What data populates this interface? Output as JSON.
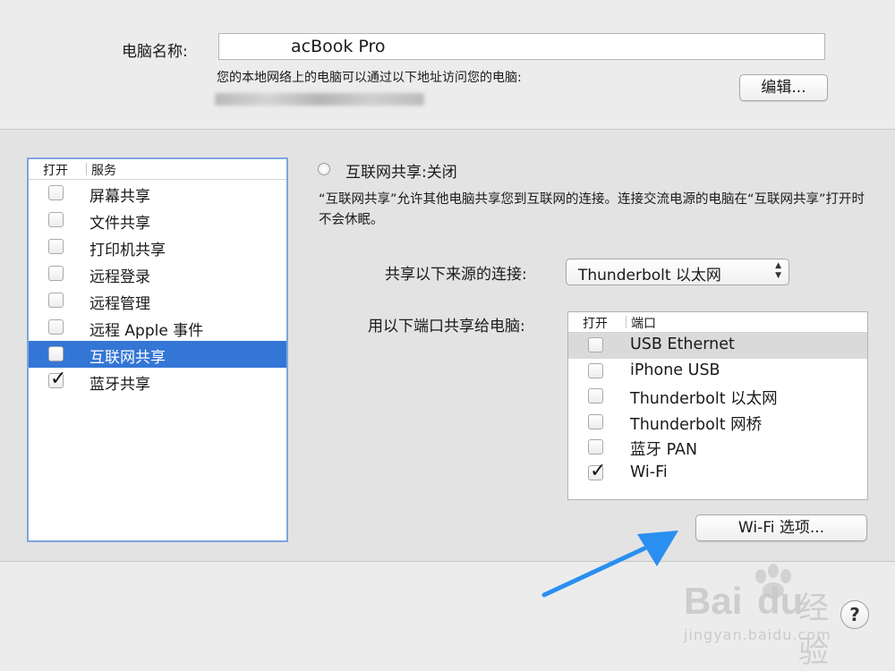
{
  "top": {
    "name_label": "电脑名称:",
    "name_value": "acBook Pro",
    "network_note": "您的本地网络上的电脑可以通过以下地址访问您的电脑:",
    "edit_button": "编辑..."
  },
  "services": {
    "col_on": "打开",
    "col_service": "服务",
    "items": [
      {
        "label": "屏幕共享",
        "checked": false,
        "selected": false
      },
      {
        "label": "文件共享",
        "checked": false,
        "selected": false
      },
      {
        "label": "打印机共享",
        "checked": false,
        "selected": false
      },
      {
        "label": "远程登录",
        "checked": false,
        "selected": false
      },
      {
        "label": "远程管理",
        "checked": false,
        "selected": false
      },
      {
        "label": "远程 Apple 事件",
        "checked": false,
        "selected": false
      },
      {
        "label": "互联网共享",
        "checked": false,
        "selected": true
      },
      {
        "label": "蓝牙共享",
        "checked": true,
        "selected": false
      }
    ]
  },
  "detail": {
    "status": "互联网共享:关闭",
    "description": "“互联网共享”允许其他电脑共享您到互联网的连接。连接交流电源的电脑在“互联网共享”打开时不会休眠。",
    "source_label": "共享以下来源的连接:",
    "source_value": "Thunderbolt 以太网",
    "ports_label": "用以下端口共享给电脑:",
    "ports_col_on": "打开",
    "ports_col_port": "端口",
    "ports": [
      {
        "label": "USB Ethernet",
        "checked": false,
        "highlighted": true
      },
      {
        "label": "iPhone USB",
        "checked": false,
        "highlighted": false
      },
      {
        "label": "Thunderbolt 以太网",
        "checked": false,
        "highlighted": false
      },
      {
        "label": "Thunderbolt 网桥",
        "checked": false,
        "highlighted": false
      },
      {
        "label": "蓝牙 PAN",
        "checked": false,
        "highlighted": false
      },
      {
        "label": "Wi-Fi",
        "checked": true,
        "highlighted": false
      }
    ],
    "wifi_options_button": "Wi-Fi 选项..."
  },
  "help_button": "?",
  "watermark": {
    "brand": "Bai",
    "brand2": "du",
    "brand_cn": "经验",
    "url": "jingyan.baidu.com"
  },
  "colors": {
    "selection": "#3476d6",
    "annotation_arrow": "#2a8ff0"
  }
}
